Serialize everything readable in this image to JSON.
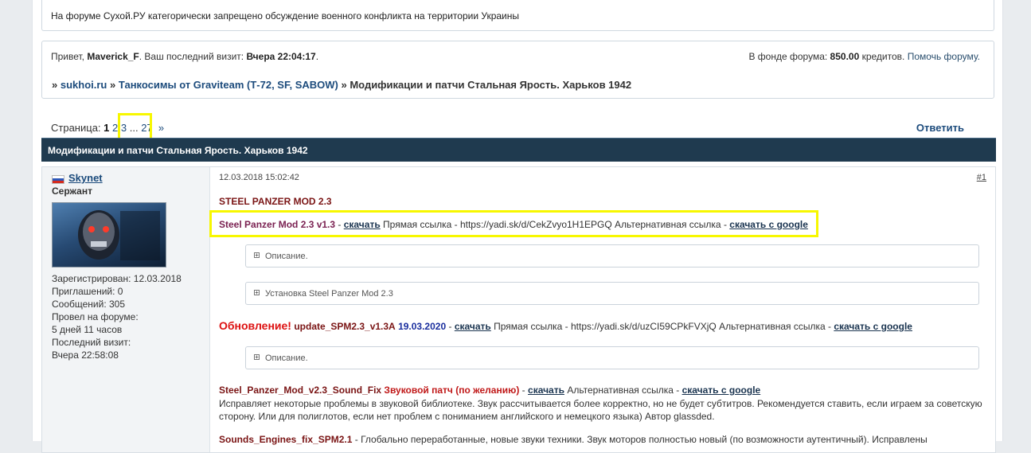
{
  "notice": {
    "text": "На форуме Сухой.РУ категорически запрещено обсуждение военного конфликта на территории Украины"
  },
  "userinfo": {
    "greeting": "Привет,",
    "username": "Maverick_F",
    "last_visit_label": ". Ваш последний визит:",
    "last_visit": "Вчера 22:04:17",
    "fund_label": "В фонде форума:",
    "fund_amount": "850.00",
    "fund_unit": "кредитов.",
    "help_link": "Помочь форуму."
  },
  "breadcrumb": {
    "sep": "»",
    "items": [
      "sukhoi.ru",
      "Танкосимы от Graviteam (Т-72, SF, SABOW)",
      "Модификации и патчи Стальная Ярость. Харьков 1942"
    ]
  },
  "pagination": {
    "label": "Страница:",
    "current": "1",
    "p2": "2",
    "p3": "3",
    "ellipsis": "...",
    "last": "27",
    "next": "»"
  },
  "reply_label": "Ответить",
  "topic_title": "Модификации и патчи Стальная Ярость. Харьков 1942",
  "post": {
    "author": {
      "name": "Skynet",
      "rank": "Сержант",
      "stats": [
        "Зарегистрирован: 12.03.2018",
        "Приглашений: 0",
        "Сообщений: 305",
        "Провел на форуме:",
        "5 дней 11 часов",
        "Последний визит:",
        "Вчера 22:58:08"
      ]
    },
    "date": "12.03.2018 15:02:42",
    "number": "#1",
    "mod_title": "STEEL PANZER MOD 2.3",
    "line1": {
      "name": "Steel Panzer Mod 2.3 v1.3",
      "dash": "-",
      "download": "скачать",
      "direct": "Прямая ссылка - https://yadi.sk/d/CekZvyo1H1EPGQ Альтернативная ссылка -",
      "google": "скачать с google"
    },
    "spoiler1": "Описание.",
    "spoiler2": "Установка Steel Panzer Mod 2.3",
    "update": {
      "label": "Обновление!",
      "name": "update_SPM2.3_v1.3A",
      "date": "19.03.2020",
      "dash": "-",
      "download": "скачать",
      "direct": "Прямая ссылка - https://yadi.sk/d/uzCI59CPkFVXjQ Альтернативная ссылка -",
      "google": "скачать с google"
    },
    "spoiler3": "Описание.",
    "sound": {
      "name": "Steel_Panzer_Mod_v2.3_Sound_Fix",
      "desc": "Звуковой патч (по желанию)",
      "dash": "-",
      "download": "скачать",
      "alt": "Альтернативная ссылка -",
      "google": "скачать с google",
      "text1": "Исправляет некоторые проблемы в звуковой библиотеке. Звук рассчитывается более корректно, но не будет субтитров. Рекомендуется ставить, если играем за советскую",
      "text2": "сторону. Или для полиглотов, если нет проблем с пониманием английского и немецкого языка) Автор glassded."
    },
    "engines": {
      "name": "Sounds_Engines_fix_SPM2.1",
      "text": "- Глобально переработанные, новые звуки техники. Звук моторов полностью новый (по возможности аутентичный). Исправлены"
    }
  }
}
